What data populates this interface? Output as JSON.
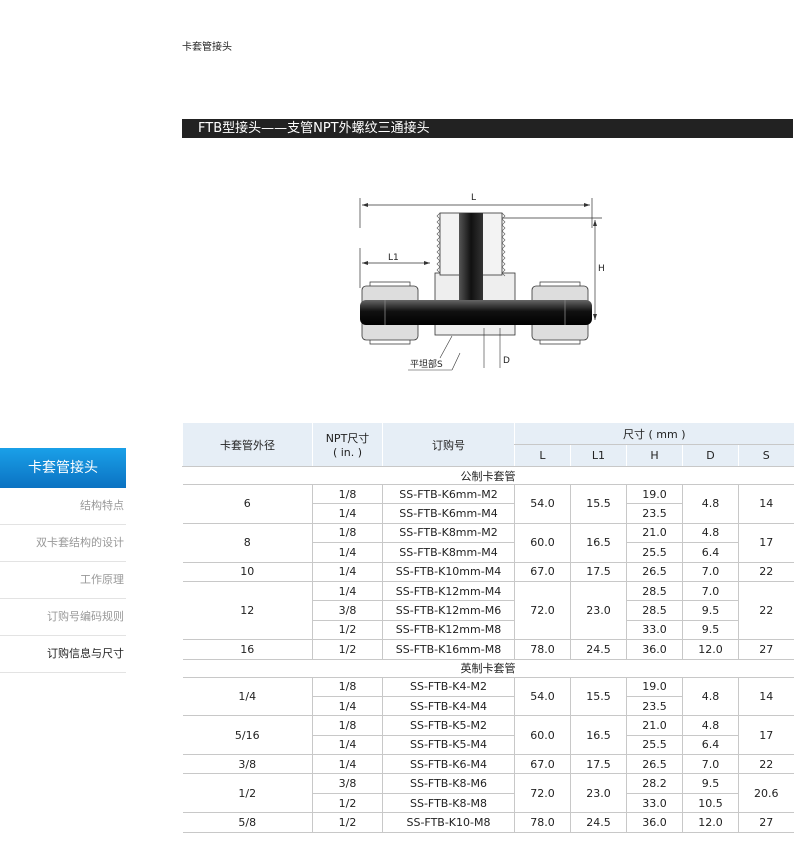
{
  "breadcrumb": "卡套管接头",
  "title": "FTB型接头——支管NPT外螺纹三通接头",
  "diagram_labels": {
    "L": "L",
    "L1": "L1",
    "H": "H",
    "D": "D",
    "S": "平坦部S"
  },
  "sidebar": {
    "active": "卡套管接头",
    "items": [
      "结构特点",
      "双卡套结构的设计",
      "工作原理",
      "订购号编码规则",
      "订购信息与尺寸"
    ]
  },
  "table": {
    "headers": {
      "od": "卡套管外径",
      "npt_line1": "NPT尺寸",
      "npt_line2": "( in. )",
      "order": "订购号",
      "dims": "尺寸 ( mm )",
      "L": "L",
      "L1": "L1",
      "H": "H",
      "D": "D",
      "S": "S"
    },
    "sections": [
      {
        "title": "公制卡套管",
        "groups": [
          {
            "od": "6",
            "L": "54.0",
            "L1": "15.5",
            "S": "14",
            "rows": [
              {
                "npt": "1/8",
                "order": "SS-FTB-K6mm-M2",
                "H": "19.0",
                "D": "4.8"
              },
              {
                "npt": "1/4",
                "order": "SS-FTB-K6mm-M4",
                "H": "23.5",
                "D": ""
              }
            ],
            "dmerge": true
          },
          {
            "od": "8",
            "L": "60.0",
            "L1": "16.5",
            "S": "17",
            "rows": [
              {
                "npt": "1/8",
                "order": "SS-FTB-K8mm-M2",
                "H": "21.0",
                "D": "4.8"
              },
              {
                "npt": "1/4",
                "order": "SS-FTB-K8mm-M4",
                "H": "25.5",
                "D": "6.4"
              }
            ]
          },
          {
            "od": "10",
            "L": "67.0",
            "L1": "17.5",
            "S": "22",
            "rows": [
              {
                "npt": "1/4",
                "order": "SS-FTB-K10mm-M4",
                "H": "26.5",
                "D": "7.0"
              }
            ]
          },
          {
            "od": "12",
            "L": "72.0",
            "L1": "23.0",
            "S": "22",
            "rows": [
              {
                "npt": "1/4",
                "order": "SS-FTB-K12mm-M4",
                "H": "28.5",
                "D": "7.0"
              },
              {
                "npt": "3/8",
                "order": "SS-FTB-K12mm-M6",
                "H": "28.5",
                "D": "9.5"
              },
              {
                "npt": "1/2",
                "order": "SS-FTB-K12mm-M8",
                "H": "33.0",
                "D": "9.5"
              }
            ]
          },
          {
            "od": "16",
            "L": "78.0",
            "L1": "24.5",
            "S": "27",
            "rows": [
              {
                "npt": "1/2",
                "order": "SS-FTB-K16mm-M8",
                "H": "36.0",
                "D": "12.0"
              }
            ]
          }
        ]
      },
      {
        "title": "英制卡套管",
        "groups": [
          {
            "od": "1/4",
            "L": "54.0",
            "L1": "15.5",
            "S": "14",
            "rows": [
              {
                "npt": "1/8",
                "order": "SS-FTB-K4-M2",
                "H": "19.0",
                "D": "4.8"
              },
              {
                "npt": "1/4",
                "order": "SS-FTB-K4-M4",
                "H": "23.5",
                "D": ""
              }
            ],
            "dmerge": true
          },
          {
            "od": "5/16",
            "L": "60.0",
            "L1": "16.5",
            "S": "17",
            "rows": [
              {
                "npt": "1/8",
                "order": "SS-FTB-K5-M2",
                "H": "21.0",
                "D": "4.8"
              },
              {
                "npt": "1/4",
                "order": "SS-FTB-K5-M4",
                "H": "25.5",
                "D": "6.4"
              }
            ]
          },
          {
            "od": "3/8",
            "L": "67.0",
            "L1": "17.5",
            "S": "22",
            "rows": [
              {
                "npt": "1/4",
                "order": "SS-FTB-K6-M4",
                "H": "26.5",
                "D": "7.0"
              }
            ]
          },
          {
            "od": "1/2",
            "L": "72.0",
            "L1": "23.0",
            "S": "20.6",
            "rows": [
              {
                "npt": "3/8",
                "order": "SS-FTB-K8-M6",
                "H": "28.2",
                "D": "9.5"
              },
              {
                "npt": "1/2",
                "order": "SS-FTB-K8-M8",
                "H": "33.0",
                "D": "10.5"
              }
            ]
          },
          {
            "od": "5/8",
            "L": "78.0",
            "L1": "24.5",
            "S": "27",
            "rows": [
              {
                "npt": "1/2",
                "order": "SS-FTB-K10-M8",
                "H": "36.0",
                "D": "12.0"
              }
            ]
          }
        ]
      }
    ]
  }
}
